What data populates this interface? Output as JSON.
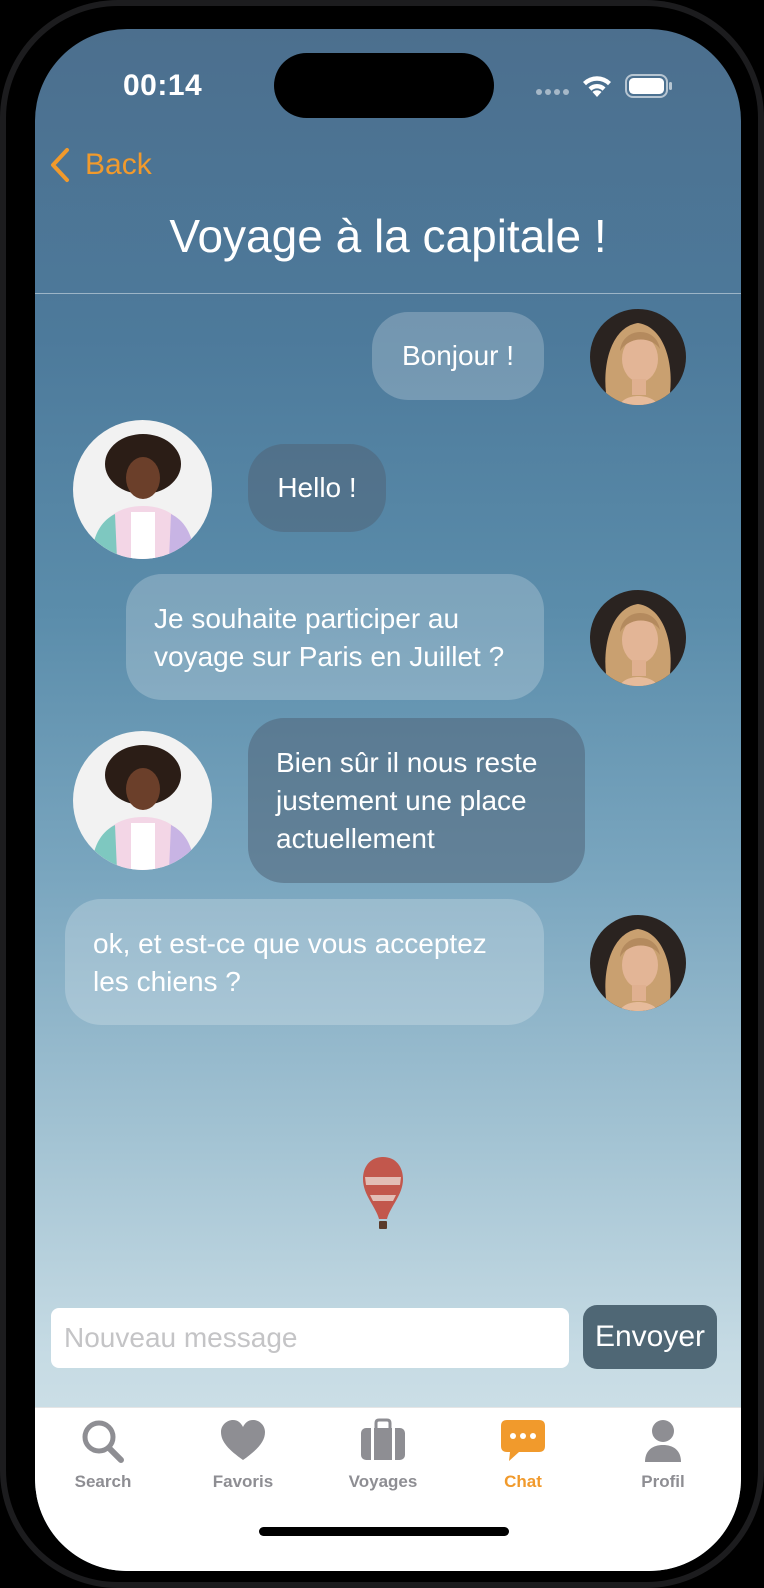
{
  "status_bar": {
    "time": "00:14"
  },
  "nav": {
    "back_label": "Back",
    "title": "Voyage à la capitale !"
  },
  "messages": [
    {
      "sender": "me",
      "text": "Bonjour !"
    },
    {
      "sender": "them",
      "text": "Hello !"
    },
    {
      "sender": "me",
      "text": "Je souhaite participer au voyage sur Paris en Juillet ?"
    },
    {
      "sender": "them",
      "text": "Bien sûr il nous reste justement une place actuellement"
    },
    {
      "sender": "me",
      "text": "ok, et est-ce que vous acceptez les chiens ?"
    }
  ],
  "composer": {
    "placeholder": "Nouveau message",
    "send_label": "Envoyer"
  },
  "tabs": [
    {
      "label": "Search",
      "icon": "search-icon",
      "active": false
    },
    {
      "label": "Favoris",
      "icon": "heart-icon",
      "active": false
    },
    {
      "label": "Voyages",
      "icon": "suitcase-icon",
      "active": false
    },
    {
      "label": "Chat",
      "icon": "chat-bubble-icon",
      "active": true
    },
    {
      "label": "Profil",
      "icon": "person-icon",
      "active": false
    }
  ],
  "colors": {
    "accent": "#f19a2c",
    "inactive": "#8e8e93",
    "send_button": "#4f6775"
  }
}
